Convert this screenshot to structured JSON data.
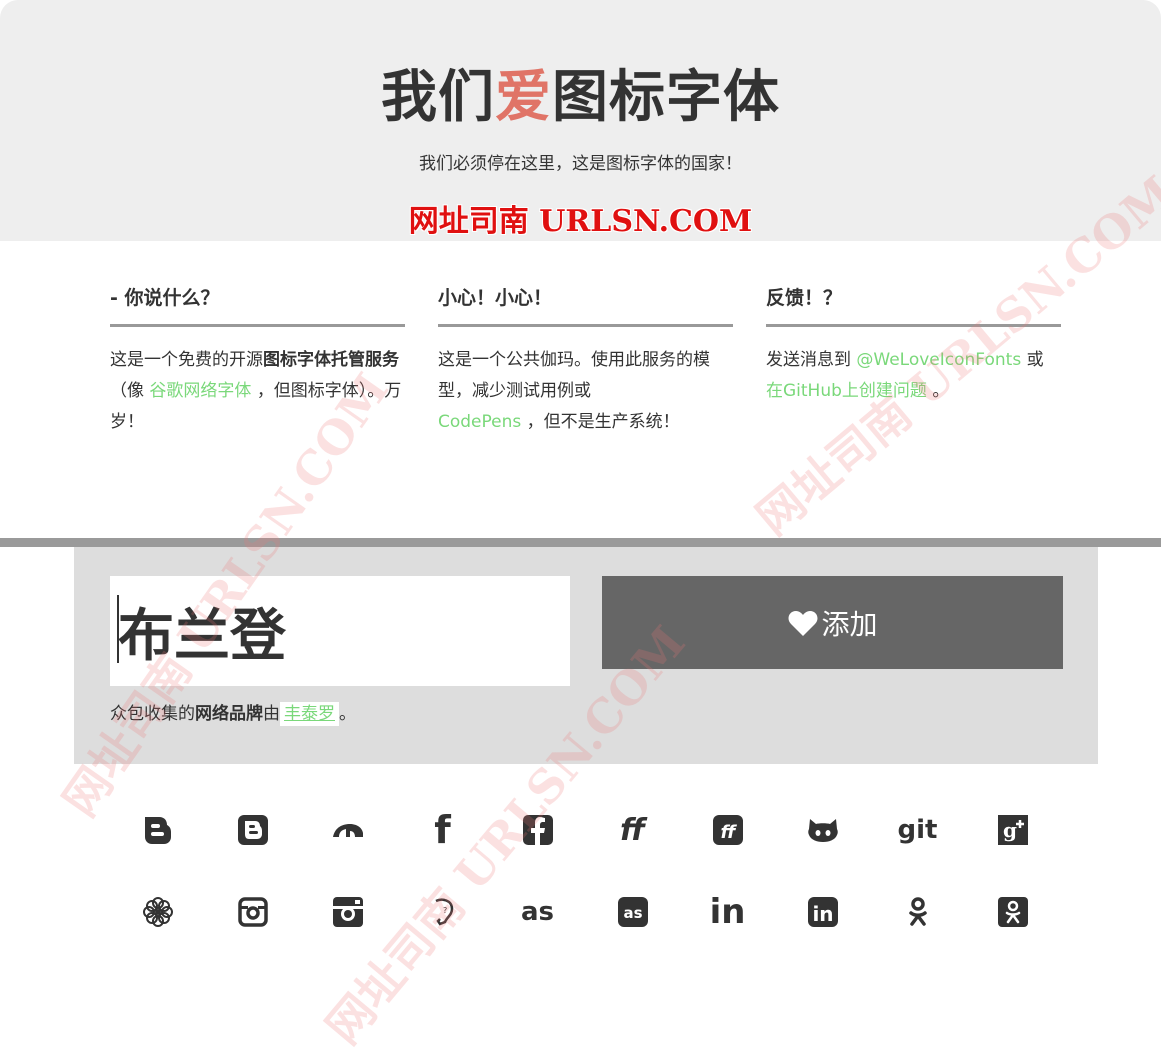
{
  "hero": {
    "title_part1": "我们",
    "title_love": "爱",
    "title_part2": "图标字体",
    "subtitle": "我们必须停在这里，这是图标字体的国家！",
    "brand": "网址司南 URLSN.COM"
  },
  "columns": [
    {
      "heading": "- 你说什么？",
      "text_a": "这是一个免费的开源",
      "text_bold": "图标字体托管服务",
      "text_b": "（像",
      "link": "谷歌网络字体",
      "text_c": "，但图标字体）。万岁！"
    },
    {
      "heading": "小心！小心！",
      "text_a": "这是一个公共伽玛。使用此服务的模型，减少测试用例或",
      "link": "CodePens",
      "text_b": "，但不是生产系统！"
    },
    {
      "heading": "反馈！？",
      "text_a": "发送消息到",
      "link1": "@WeLoveIconFonts",
      "text_b": "或",
      "link2": "在GitHub上创建问题",
      "text_c": "。"
    }
  ],
  "form": {
    "name_value": "布兰登",
    "add_label": "添加",
    "credit_a": "众包收集的",
    "credit_bold": "网络品牌",
    "credit_b": "由",
    "credit_link": "丰泰罗",
    "credit_c": "。"
  },
  "icons": {
    "row1": [
      "blogger-icon",
      "blogger-square-icon",
      "deviantart-icon",
      "facebook-icon",
      "facebook-square-icon",
      "friendfeed-icon",
      "friendfeed-square-icon",
      "github-icon",
      "git-icon",
      "google-plus-icon"
    ],
    "row2": [
      "flickr-flower-icon",
      "instagram-icon",
      "instagram-square-icon",
      "lanyrd-icon",
      "lastfm-icon",
      "lastfm-square-icon",
      "linkedin-icon",
      "linkedin-square-icon",
      "odnoklassniki-icon",
      "odnoklassniki-square-icon"
    ],
    "git_text": "git",
    "gplus_text": "g+",
    "lastfm_text": "as",
    "linkedin_text": "in",
    "ff_text": "ff",
    "f_text": "f"
  },
  "watermark": "网址司南 URLSN.COM"
}
